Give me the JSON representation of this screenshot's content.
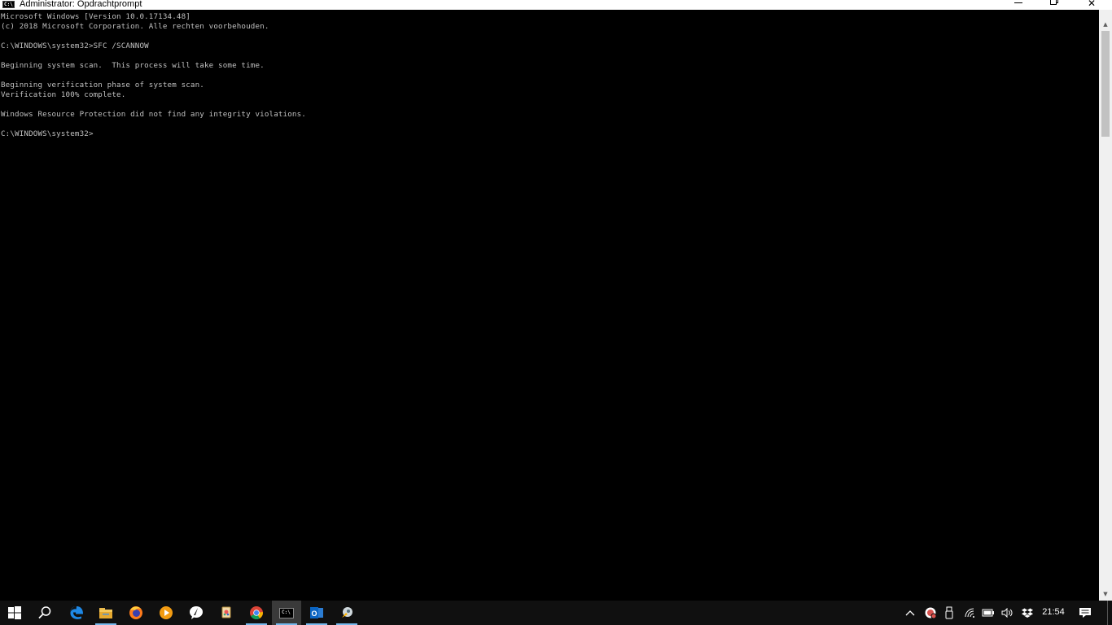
{
  "window": {
    "title": "Administrator: Opdrachtprompt",
    "icon_text": "C:\\"
  },
  "console": {
    "lines": [
      "Microsoft Windows [Version 10.0.17134.48]",
      "(c) 2018 Microsoft Corporation. Alle rechten voorbehouden.",
      "",
      "C:\\WINDOWS\\system32>SFC /SCANNOW",
      "",
      "Beginning system scan.  This process will take some time.",
      "",
      "Beginning verification phase of system scan.",
      "Verification 100% complete.",
      "",
      "Windows Resource Protection did not find any integrity violations.",
      "",
      "C:\\WINDOWS\\system32>"
    ]
  },
  "taskbar": {
    "apps": [
      {
        "name": "start-icon"
      },
      {
        "name": "search-icon"
      },
      {
        "name": "edge-icon"
      },
      {
        "name": "file-explorer-icon"
      },
      {
        "name": "firefox-icon"
      },
      {
        "name": "media-player-icon"
      },
      {
        "name": "feather-app-icon"
      },
      {
        "name": "paint-app-icon"
      },
      {
        "name": "chrome-icon"
      },
      {
        "name": "command-prompt-icon"
      },
      {
        "name": "outlook-icon"
      },
      {
        "name": "app-icon"
      }
    ],
    "cmd_icon_text": "C:\\",
    "outlook_letter": "O",
    "clock": "21:54"
  },
  "colors": {
    "console_bg": "#000000",
    "console_text": "#c0c0c0",
    "taskbar_bg": "#101010",
    "taskbar_active": "#3a3a3a",
    "accent": "#76b9ed"
  }
}
